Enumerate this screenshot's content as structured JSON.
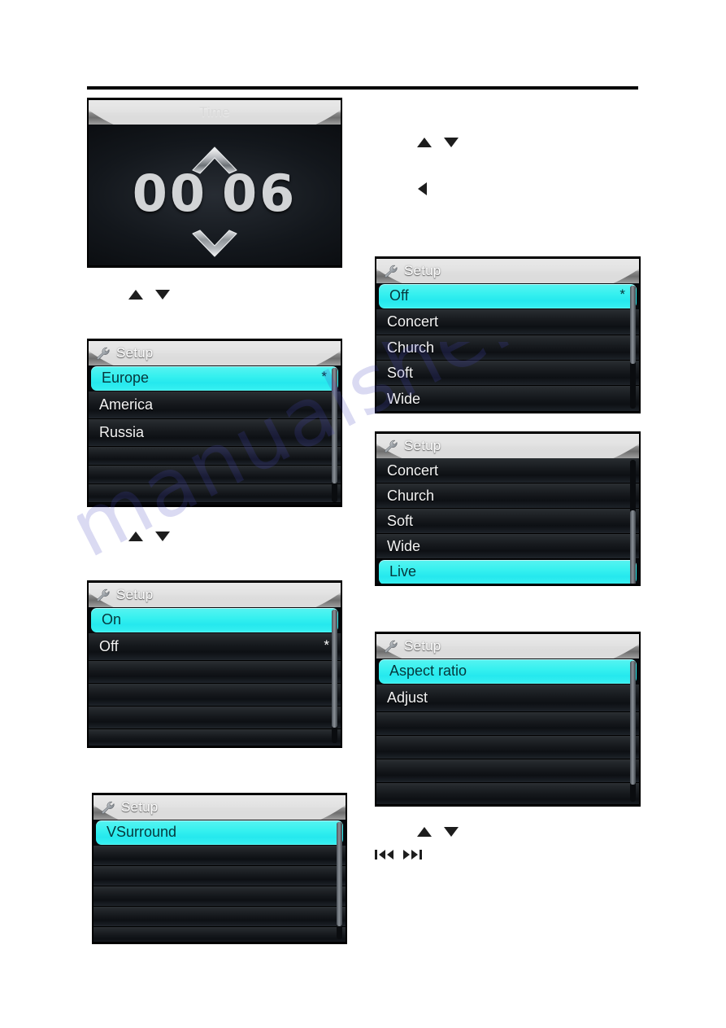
{
  "page": {
    "watermark_text": "manualshe.com"
  },
  "panels": {
    "time": {
      "title": "Time",
      "hours": "00",
      "minutes": "06",
      "up_icon": "chevron-up-icon",
      "down_icon": "chevron-down-icon"
    },
    "region": {
      "title": "Setup",
      "icon": "wrench-icon",
      "rows": [
        {
          "label": "Europe",
          "mark": "*",
          "selected": true
        },
        {
          "label": "America",
          "mark": "",
          "selected": false
        },
        {
          "label": "Russia",
          "mark": "",
          "selected": false
        },
        {
          "label": "",
          "mark": "",
          "selected": false
        },
        {
          "label": "",
          "mark": "",
          "selected": false
        },
        {
          "label": "",
          "mark": "",
          "selected": false
        }
      ]
    },
    "onoff": {
      "title": "Setup",
      "icon": "wrench-icon",
      "rows": [
        {
          "label": "On",
          "mark": "",
          "selected": true
        },
        {
          "label": "Off",
          "mark": "*",
          "selected": false
        },
        {
          "label": "",
          "mark": "",
          "selected": false
        },
        {
          "label": "",
          "mark": "",
          "selected": false
        },
        {
          "label": "",
          "mark": "",
          "selected": false
        },
        {
          "label": "",
          "mark": "",
          "selected": false
        }
      ]
    },
    "vsurround": {
      "title": "Setup",
      "icon": "wrench-icon",
      "rows": [
        {
          "label": "VSurround",
          "mark": "",
          "selected": true
        },
        {
          "label": "",
          "mark": "",
          "selected": false
        },
        {
          "label": "",
          "mark": "",
          "selected": false
        },
        {
          "label": "",
          "mark": "",
          "selected": false
        },
        {
          "label": "",
          "mark": "",
          "selected": false
        },
        {
          "label": "",
          "mark": "",
          "selected": false
        }
      ]
    },
    "eq_top": {
      "title": "Setup",
      "icon": "wrench-icon",
      "rows": [
        {
          "label": "Off",
          "mark": "*",
          "selected": true
        },
        {
          "label": "Concert",
          "mark": "",
          "selected": false
        },
        {
          "label": "Church",
          "mark": "",
          "selected": false
        },
        {
          "label": "Soft",
          "mark": "",
          "selected": false
        },
        {
          "label": "Wide",
          "mark": "",
          "selected": false
        }
      ]
    },
    "eq_bottom": {
      "title": "Setup",
      "icon": "wrench-icon",
      "rows": [
        {
          "label": "Concert",
          "mark": "",
          "selected": false
        },
        {
          "label": "Church",
          "mark": "",
          "selected": false
        },
        {
          "label": "Soft",
          "mark": "",
          "selected": false
        },
        {
          "label": "Wide",
          "mark": "",
          "selected": false
        },
        {
          "label": "Live",
          "mark": "",
          "selected": true
        }
      ]
    },
    "video": {
      "title": "Setup",
      "icon": "wrench-icon",
      "rows": [
        {
          "label": "Aspect ratio",
          "mark": "",
          "selected": true
        },
        {
          "label": "Adjust",
          "mark": "",
          "selected": false
        },
        {
          "label": "",
          "mark": "",
          "selected": false
        },
        {
          "label": "",
          "mark": "",
          "selected": false
        },
        {
          "label": "",
          "mark": "",
          "selected": false
        },
        {
          "label": "",
          "mark": "",
          "selected": false
        }
      ]
    }
  },
  "hints": {
    "left_after_time": {
      "up": "triangle-up-icon",
      "down": "triangle-down-icon"
    },
    "left_after_region": {
      "up": "triangle-up-icon",
      "down": "triangle-down-icon"
    },
    "right_top": {
      "up": "triangle-up-icon",
      "down": "triangle-down-icon"
    },
    "right_left": {
      "left": "triangle-left-icon"
    },
    "right_bottom": {
      "up": "triangle-up-icon",
      "down": "triangle-down-icon"
    },
    "right_skip": {
      "prev": "skip-previous-icon",
      "next": "skip-next-icon"
    }
  },
  "colors": {
    "highlight": "#34f0ef",
    "panel_bg": "#0b0e12",
    "titlebar_silver": "#bdbdbd",
    "text_light": "#f2f2f2"
  }
}
